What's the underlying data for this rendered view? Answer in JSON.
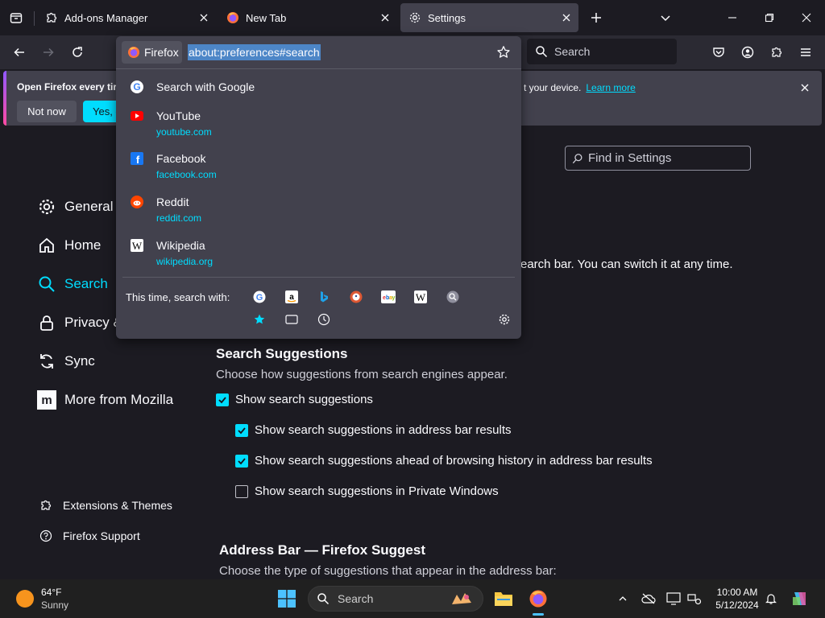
{
  "colors": {
    "accent": "#00ddff",
    "tab_selected": "#42414d",
    "page_bg": "#1c1b22",
    "popup_bg": "#42414d",
    "toolbar_bg": "#2b2a33"
  },
  "tabs": [
    {
      "label": "Add-ons Manager",
      "icon": "puzzle-icon",
      "selected": false
    },
    {
      "label": "New Tab",
      "icon": "firefox-icon",
      "selected": false
    },
    {
      "label": "Settings",
      "icon": "gear-icon",
      "selected": true
    }
  ],
  "navbar": {
    "search_placeholder": "Search"
  },
  "urlbar": {
    "identity_label": "Firefox",
    "url": "about:preferences#search"
  },
  "popup": {
    "first_row": "Search with Google",
    "results": [
      {
        "title": "YouTube",
        "url": "youtube.com",
        "icon": "youtube-icon"
      },
      {
        "title": "Facebook",
        "url": "facebook.com",
        "icon": "facebook-icon"
      },
      {
        "title": "Reddit",
        "url": "reddit.com",
        "icon": "reddit-icon"
      },
      {
        "title": "Wikipedia",
        "url": "wikipedia.org",
        "icon": "wikipedia-icon"
      }
    ],
    "this_time_label": "This time, search with:",
    "engines": [
      "google-icon",
      "amazon-icon",
      "bing-icon",
      "duckduckgo-icon",
      "ebay-icon",
      "wikipedia-icon",
      "search-engine-icon",
      "bookmarks-star-icon",
      "tabs-icon",
      "history-icon",
      "search-settings-icon"
    ]
  },
  "notification": {
    "text": "Open Firefox every tir",
    "tail_text": "t your device.",
    "learn_more": "Learn more",
    "not_now": "Not now",
    "yes": "Yes, o"
  },
  "settings": {
    "find_placeholder": "Find in Settings",
    "categories": [
      {
        "label": "General",
        "icon": "gear-icon"
      },
      {
        "label": "Home",
        "icon": "home-icon"
      },
      {
        "label": "Search",
        "icon": "search-icon",
        "selected": true
      },
      {
        "label": "Privacy &",
        "icon": "lock-icon"
      },
      {
        "label": "Sync",
        "icon": "sync-icon"
      },
      {
        "label": "More from Mozilla",
        "icon": "mozilla-icon"
      }
    ],
    "footer_links": [
      {
        "label": "Extensions & Themes",
        "icon": "puzzle-icon"
      },
      {
        "label": "Firefox Support",
        "icon": "help-icon"
      }
    ],
    "engine_desc_tail": "earch bar. You can switch it at any time.",
    "suggestions_title": "Search Suggestions",
    "suggestions_desc": "Choose how suggestions from search engines appear.",
    "checkboxes": [
      {
        "label": "Show search suggestions",
        "checked": true
      },
      {
        "label": "Show search suggestions in address bar results",
        "checked": true
      },
      {
        "label": "Show search suggestions ahead of browsing history in address bar results",
        "checked": true
      },
      {
        "label": "Show search suggestions in Private Windows",
        "checked": false
      }
    ],
    "addressbar_title": "Address Bar — Firefox Suggest",
    "addressbar_desc": "Choose the type of suggestions that appear in the address bar:"
  },
  "taskbar": {
    "weather_temp": "64°F",
    "weather_desc": "Sunny",
    "search_placeholder": "Search",
    "time": "10:00 AM",
    "date": "5/12/2024"
  }
}
